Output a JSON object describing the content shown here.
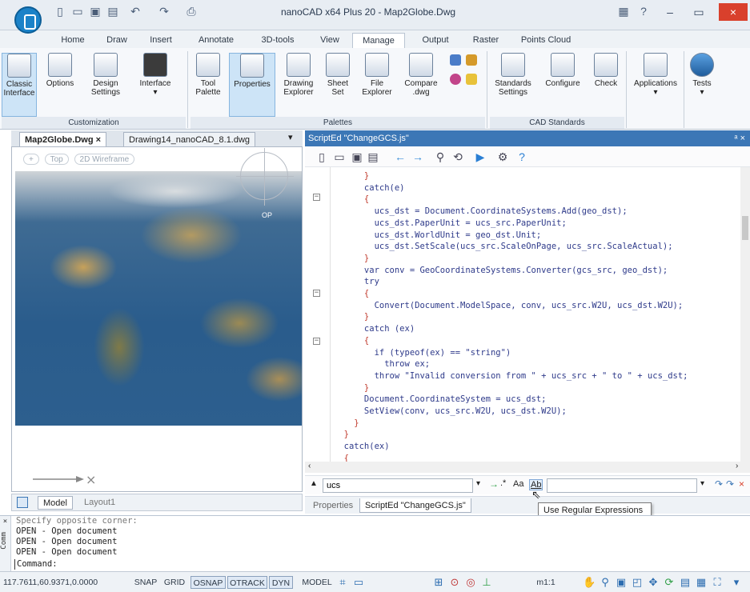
{
  "window": {
    "title": "nanoCAD x64 Plus 20 - Map2Globe.Dwg",
    "help": "?"
  },
  "ribbon": {
    "tabs": [
      "Home",
      "Draw",
      "Insert",
      "Annotate",
      "3D-tools",
      "View",
      "Manage",
      "Output",
      "Raster",
      "Points Cloud"
    ],
    "active_tab": "Manage",
    "groups": {
      "customization": {
        "title": "Customization",
        "buttons": [
          {
            "l1": "Classic",
            "l2": "Interface"
          },
          {
            "l1": "Options",
            "l2": ""
          },
          {
            "l1": "Design",
            "l2": "Settings"
          },
          {
            "l1": "Interface",
            "l2": "▾"
          }
        ]
      },
      "palettes": {
        "title": "Palettes",
        "buttons": [
          {
            "l1": "Tool",
            "l2": "Palette"
          },
          {
            "l1": "Properties",
            "l2": ""
          },
          {
            "l1": "Drawing",
            "l2": "Explorer"
          },
          {
            "l1": "Sheet",
            "l2": "Set"
          },
          {
            "l1": "File",
            "l2": "Explorer"
          },
          {
            "l1": "Compare",
            "l2": ".dwg"
          }
        ]
      },
      "cad_standards": {
        "title": "CAD Standards",
        "buttons": [
          {
            "l1": "Standards",
            "l2": "Settings"
          },
          {
            "l1": "Configure",
            "l2": ""
          },
          {
            "l1": "Check",
            "l2": ""
          }
        ]
      },
      "applications": {
        "l1": "Applications",
        "l2": "▾"
      },
      "tests": {
        "l1": "Tests",
        "l2": "▾"
      }
    }
  },
  "documents": {
    "tabs": [
      "Map2Globe.Dwg",
      "Drawing14_nanoCAD_8.1.dwg"
    ],
    "active": "Map2Globe.Dwg",
    "close_glyph": "×",
    "menu_glyph": "▾"
  },
  "viewport": {
    "view_controls": [
      "+",
      "Top",
      "2D Wireframe"
    ],
    "map_label": "OP"
  },
  "model_tabs": [
    "Model",
    "Layout1"
  ],
  "script_editor": {
    "header": "ScriptEd \"ChangeGCS.js\"",
    "pin": "ᵃ ×",
    "code_lines": [
      {
        "text": "      }",
        "red": true
      },
      {
        "text": "      catch(e)",
        "red": false
      },
      {
        "text": "      {",
        "red": true
      },
      {
        "text": "        ucs_dst = Document.CoordinateSystems.Add(geo_dst);",
        "red": false
      },
      {
        "text": "        ucs_dst.PaperUnit = ucs_src.PaperUnit;",
        "red": false
      },
      {
        "text": "        ucs_dst.WorldUnit = geo_dst.Unit;",
        "red": false
      },
      {
        "text": "        ucs_dst.SetScale(ucs_src.ScaleOnPage, ucs_src.ScaleActual);",
        "red": false
      },
      {
        "text": "      }",
        "red": true
      },
      {
        "text": "      var conv = GeoCoordinateSystems.Converter(gcs_src, geo_dst);",
        "red": false
      },
      {
        "text": "      try",
        "red": false
      },
      {
        "text": "      {",
        "red": true
      },
      {
        "text": "        Convert(Document.ModelSpace, conv, ucs_src.W2U, ucs_dst.W2U);",
        "red": false
      },
      {
        "text": "      }",
        "red": true
      },
      {
        "text": "      catch (ex)",
        "red": false
      },
      {
        "text": "      {",
        "red": true
      },
      {
        "text": "        if (typeof(ex) == \"string\")",
        "red": false
      },
      {
        "text": "          throw ex;",
        "red": false
      },
      {
        "text": "        throw \"Invalid conversion from \" + ucs_src + \" to \" + ucs_dst;",
        "red": false
      },
      {
        "text": "      }",
        "red": true
      },
      {
        "text": "      Document.CoordinateSystem = ucs_dst;",
        "red": false
      },
      {
        "text": "      SetView(conv, ucs_src.W2U, ucs_dst.W2U);",
        "red": false
      },
      {
        "text": "    }",
        "red": true
      },
      {
        "text": "  }",
        "red": true
      },
      {
        "text": "  catch(ex)",
        "red": false
      },
      {
        "text": "  {",
        "red": true
      }
    ],
    "find_value": "ucs",
    "find_options": "Aa",
    "regex_option": "Ab",
    "bottom_tabs": [
      "Properties",
      "ScriptEd \"ChangeGCS.js\""
    ],
    "active_bottom_tab": "ScriptEd \"ChangeGCS.js\"",
    "tooltip": "Use Regular Expressions"
  },
  "command_window": {
    "lines": [
      "Specify opposite corner:",
      "OPEN - Open document",
      "OPEN - Open document",
      "OPEN - Open document",
      "Command:"
    ],
    "side_label": "Comm"
  },
  "status_bar": {
    "coordinates": "117.7611,60.9371,0.0000",
    "toggles": [
      "SNAP",
      "GRID",
      "OSNAP",
      "OTRACK",
      "DYN"
    ],
    "active_toggles": [
      "OSNAP",
      "OTRACK",
      "DYN"
    ],
    "model": "MODEL",
    "scale": "m1:1"
  }
}
